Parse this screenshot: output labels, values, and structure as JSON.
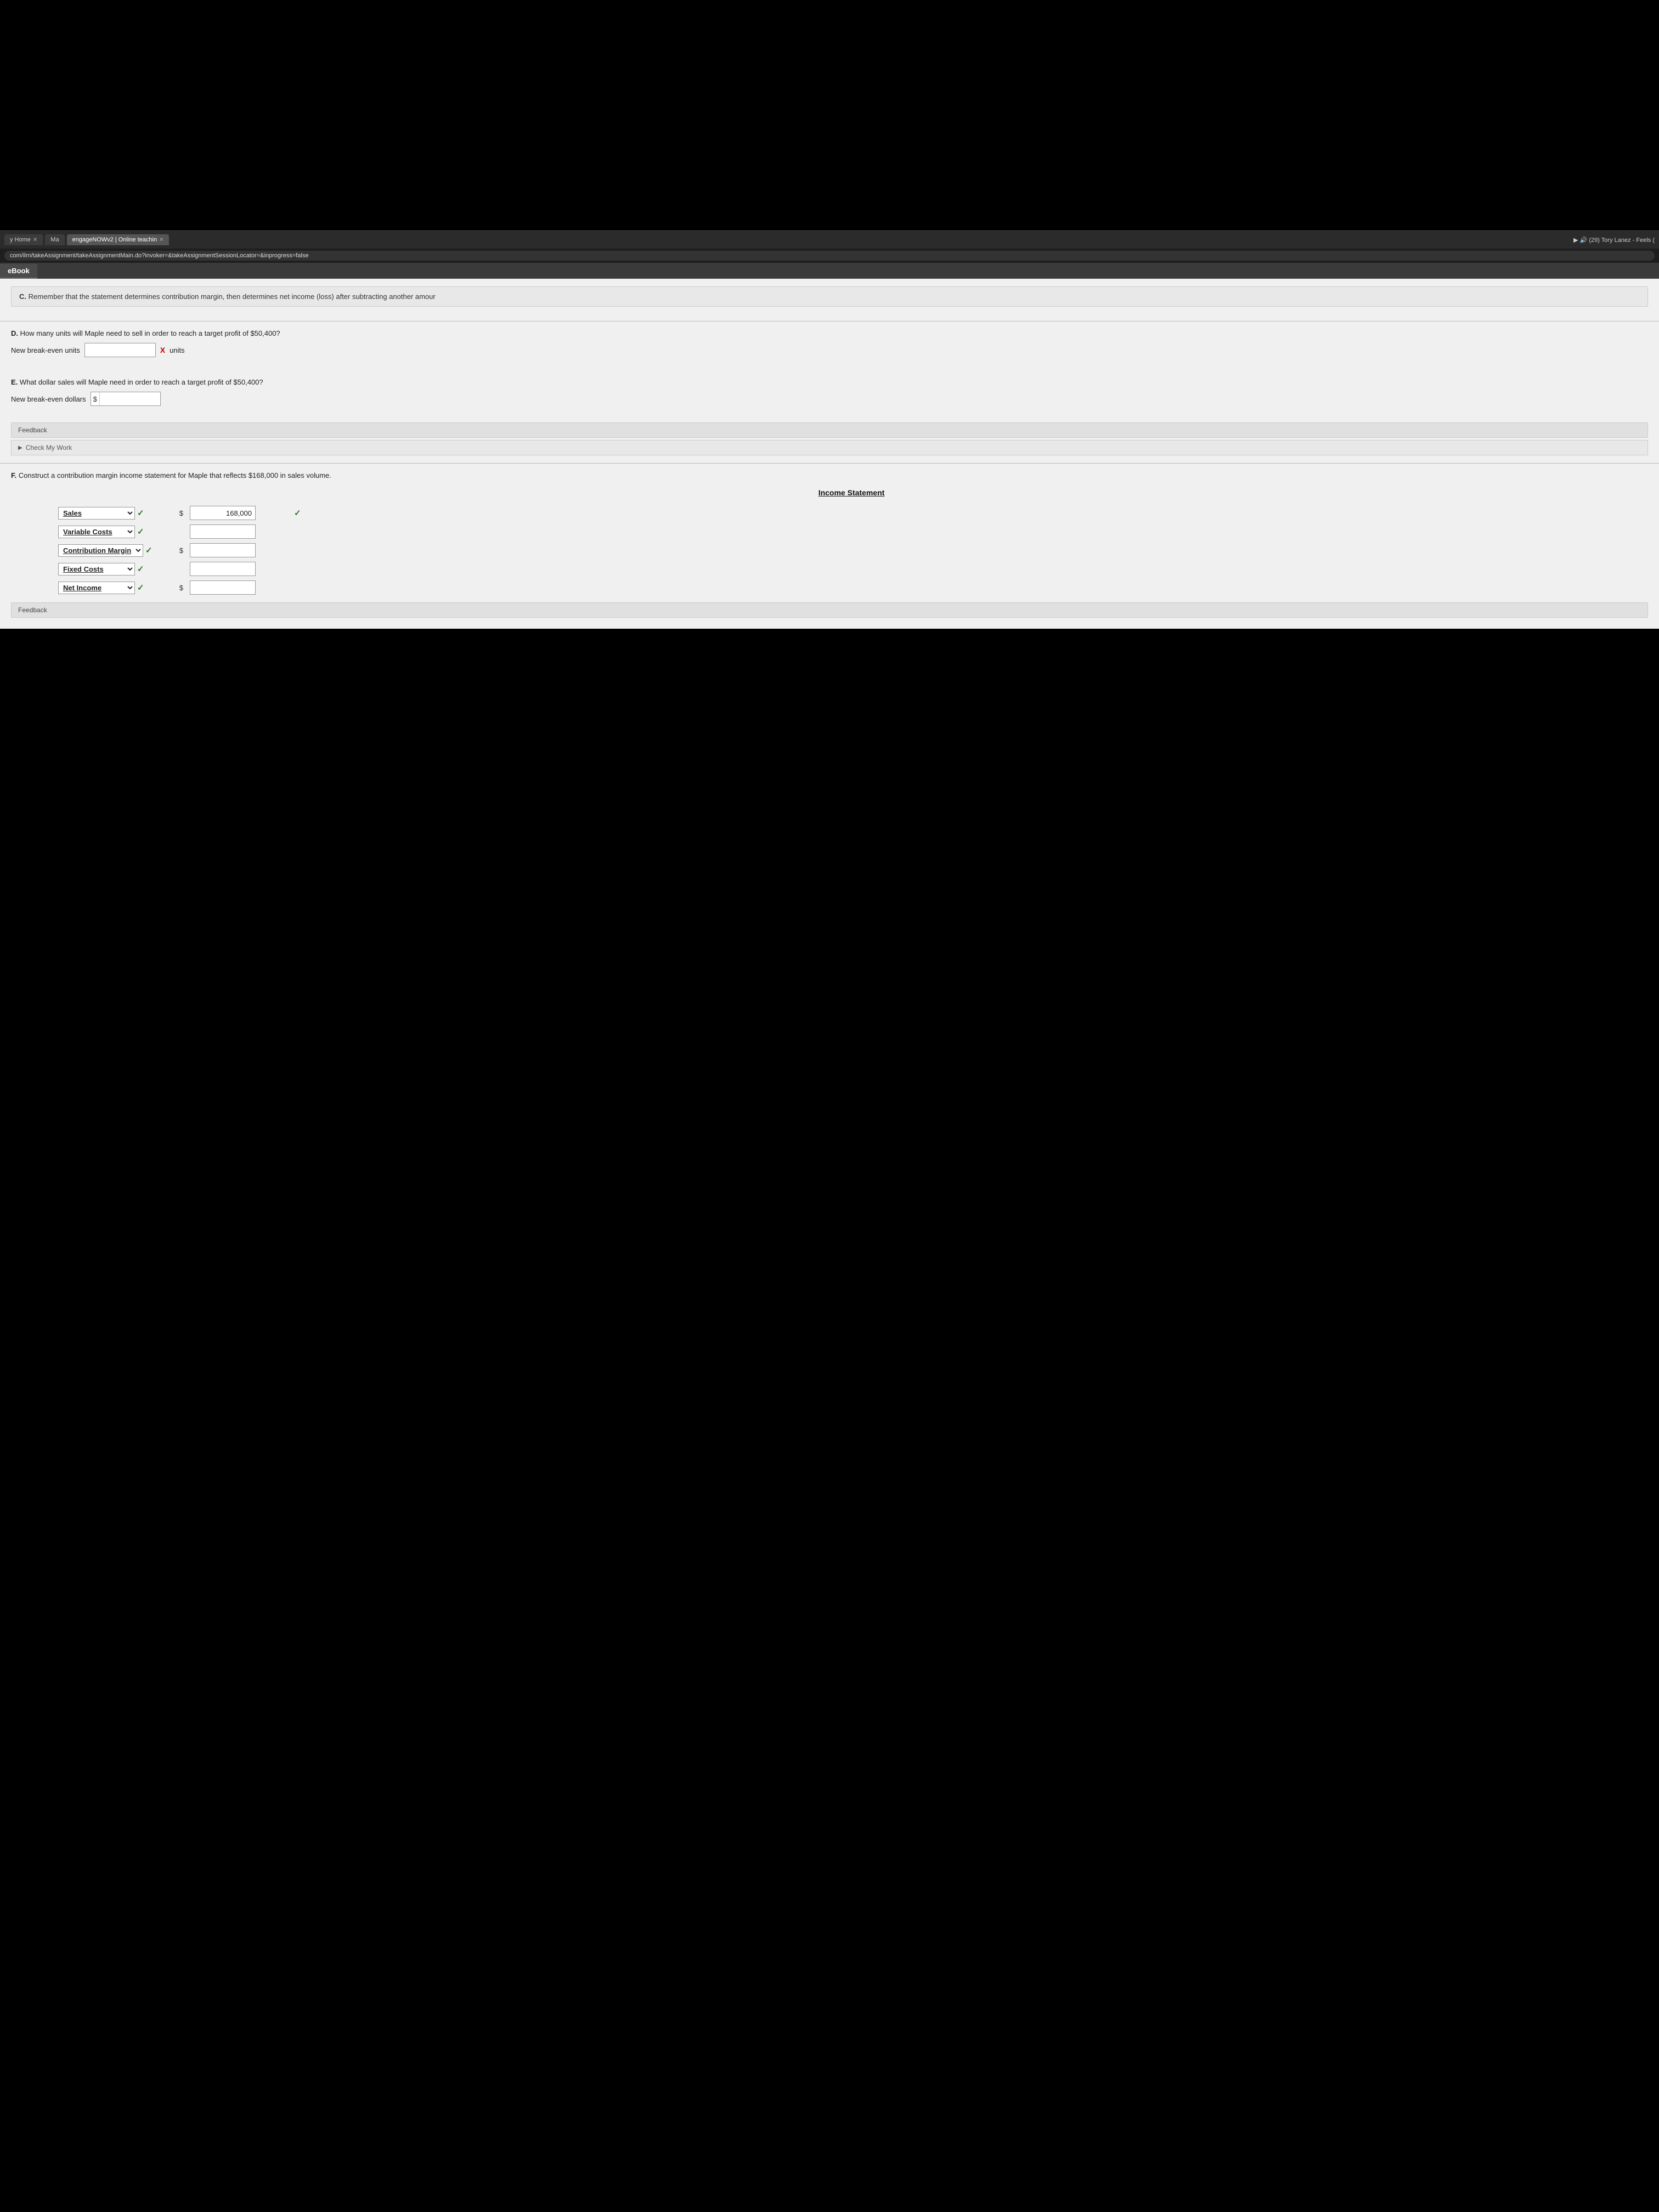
{
  "browser": {
    "address_url": "com/ilrn/takeAssignment/takeAssignmentMain.do?invoker=&takeAssignmentSessionLocator=&inprogress=false",
    "tabs": [
      {
        "label": "y Home",
        "active": false
      },
      {
        "label": "Ma",
        "active": false
      },
      {
        "label": "engageNOWv2 | Online teachin",
        "active": true
      },
      {
        "label": "X",
        "close": true
      }
    ],
    "media_controls": "(29) Tory Lanez - Feels ("
  },
  "ebook_tab": "eBook",
  "hint_c": {
    "label": "C.",
    "text": "Remember that the statement determines contribution margin, then determines net income (loss) after subtracting another amour"
  },
  "question_d": {
    "label": "D.",
    "text": "How many units will Maple need to sell in order to reach a target profit of $50,400?",
    "input_label": "New break-even units",
    "input_value": "",
    "input_placeholder": "",
    "error_mark": "X",
    "units_label": "units"
  },
  "question_e": {
    "label": "E.",
    "text": "What dollar sales will Maple need in order to reach a target profit of $50,400?",
    "input_label": "New break-even dollars",
    "prefix": "$",
    "input_value": ""
  },
  "feedback_label": "Feedback",
  "check_my_work_label": "Check My Work",
  "question_f": {
    "label": "F.",
    "text": "Construct a contribution margin income statement for Maple that reflects $168,000 in sales volume."
  },
  "income_statement": {
    "title": "Income Statement",
    "rows": [
      {
        "label": "Sales",
        "has_dropdown": true,
        "has_check": true,
        "has_dollar": true,
        "value": "168,000",
        "value_check": true,
        "dollar_sign": "$"
      },
      {
        "label": "Variable Costs",
        "has_dropdown": true,
        "has_check": true,
        "has_dollar": false,
        "value": "",
        "value_check": false,
        "dollar_sign": ""
      },
      {
        "label": "Contribution Margin",
        "has_dropdown": true,
        "has_check": true,
        "has_dollar": true,
        "value": "",
        "value_check": false,
        "dollar_sign": "$"
      },
      {
        "label": "Fixed Costs",
        "has_dropdown": true,
        "has_check": true,
        "has_dollar": false,
        "value": "",
        "value_check": false,
        "dollar_sign": ""
      },
      {
        "label": "Net Income",
        "has_dropdown": true,
        "has_check": true,
        "has_dollar": true,
        "value": "",
        "value_check": false,
        "dollar_sign": "$"
      }
    ]
  },
  "bottom_feedback_label": "Feedback"
}
